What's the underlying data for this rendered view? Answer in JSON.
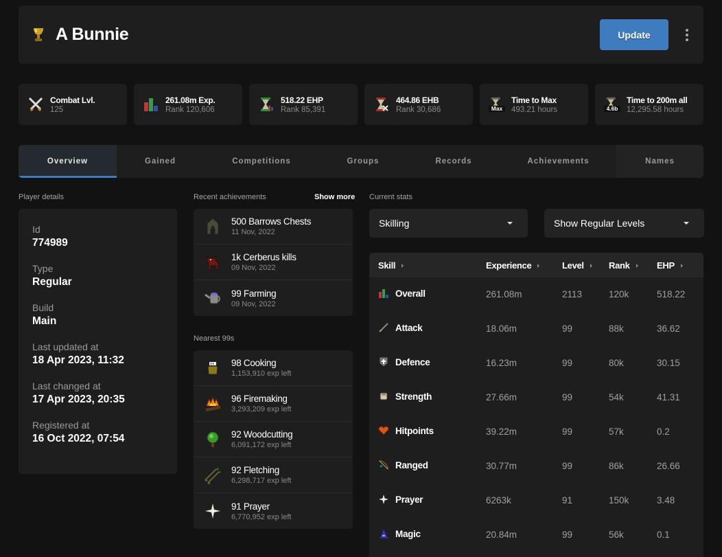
{
  "header": {
    "player_name": "A Bunnie",
    "update_label": "Update",
    "icon": "trophy-icon"
  },
  "stats": [
    {
      "icon": "crossed-swords-icon",
      "title": "Combat Lvl.",
      "sub": "125"
    },
    {
      "icon": "bar-chart-icon",
      "title": "261.08m Exp.",
      "sub": "Rank 120,606"
    },
    {
      "icon": "hourglass-green-icon",
      "title": "518.22 EHP",
      "sub": "Rank 85,391"
    },
    {
      "icon": "hourglass-red-icon",
      "title": "464.86 EHB",
      "sub": "Rank 30,686"
    },
    {
      "icon": "hourglass-max-icon",
      "title": "Time to Max",
      "sub": "493.21 hours",
      "badge": "Max"
    },
    {
      "icon": "hourglass-200m-icon",
      "title": "Time to 200m all",
      "sub": "12,295.58 hours",
      "badge": "4.6b"
    }
  ],
  "tabs": [
    {
      "label": "Overview",
      "active": true
    },
    {
      "label": "Gained"
    },
    {
      "label": "Competitions"
    },
    {
      "label": "Groups"
    },
    {
      "label": "Records"
    },
    {
      "label": "Achievements"
    },
    {
      "label": "Names"
    }
  ],
  "player_details": {
    "section_label": "Player details",
    "items": [
      {
        "label": "Id",
        "value": "774989"
      },
      {
        "label": "Type",
        "value": "Regular"
      },
      {
        "label": "Build",
        "value": "Main"
      },
      {
        "label": "Last updated at",
        "value": "18 Apr 2023, 11:32"
      },
      {
        "label": "Last changed at",
        "value": "17 Apr 2023, 20:35"
      },
      {
        "label": "Registered at",
        "value": "16 Oct 2022, 07:54"
      }
    ]
  },
  "recent_achievements": {
    "section_label": "Recent achievements",
    "show_more_label": "Show more",
    "items": [
      {
        "icon": "helmet-icon",
        "title": "500 Barrows Chests",
        "date": "11 Nov, 2022"
      },
      {
        "icon": "cerberus-icon",
        "title": "1k Cerberus kills",
        "date": "09 Nov, 2022"
      },
      {
        "icon": "watering-can-icon",
        "title": "99 Farming",
        "date": "09 Nov, 2022"
      }
    ]
  },
  "nearest_99s": {
    "section_label": "Nearest 99s",
    "items": [
      {
        "icon": "cooking-pot-icon",
        "title": "98 Cooking",
        "sub": "1,153,910 exp left"
      },
      {
        "icon": "fire-icon",
        "title": "96 Firemaking",
        "sub": "3,293,209 exp left"
      },
      {
        "icon": "tree-icon",
        "title": "92 Woodcutting",
        "sub": "6,091,172 exp left"
      },
      {
        "icon": "arrows-icon",
        "title": "92 Fletching",
        "sub": "6,298,717 exp left"
      },
      {
        "icon": "prayer-star-icon",
        "title": "91 Prayer",
        "sub": "6,770,952 exp left"
      }
    ]
  },
  "current_stats": {
    "section_label": "Current stats",
    "metric_select": "Skilling",
    "level_select": "Show Regular Levels",
    "columns": [
      "Skill",
      "Experience",
      "Level",
      "Rank",
      "EHP"
    ],
    "rows": [
      {
        "icon": "overall-icon",
        "skill": "Overall",
        "experience": "261.08m",
        "level": "2113",
        "rank": "120k",
        "ehp": "518.22"
      },
      {
        "icon": "attack-icon",
        "skill": "Attack",
        "experience": "18.06m",
        "level": "99",
        "rank": "88k",
        "ehp": "36.62"
      },
      {
        "icon": "defence-icon",
        "skill": "Defence",
        "experience": "16.23m",
        "level": "99",
        "rank": "80k",
        "ehp": "30.15"
      },
      {
        "icon": "strength-icon",
        "skill": "Strength",
        "experience": "27.66m",
        "level": "99",
        "rank": "54k",
        "ehp": "41.31"
      },
      {
        "icon": "hitpoints-icon",
        "skill": "Hitpoints",
        "experience": "39.22m",
        "level": "99",
        "rank": "57k",
        "ehp": "0.2"
      },
      {
        "icon": "ranged-icon",
        "skill": "Ranged",
        "experience": "30.77m",
        "level": "99",
        "rank": "86k",
        "ehp": "26.66"
      },
      {
        "icon": "prayer-icon",
        "skill": "Prayer",
        "experience": "6263k",
        "level": "91",
        "rank": "150k",
        "ehp": "3.48"
      },
      {
        "icon": "magic-icon",
        "skill": "Magic",
        "experience": "20.84m",
        "level": "99",
        "rank": "56k",
        "ehp": "0.1"
      }
    ]
  },
  "colors": {
    "accent": "#3f7cbf",
    "background": "#121212",
    "card": "#1e1e1e"
  }
}
